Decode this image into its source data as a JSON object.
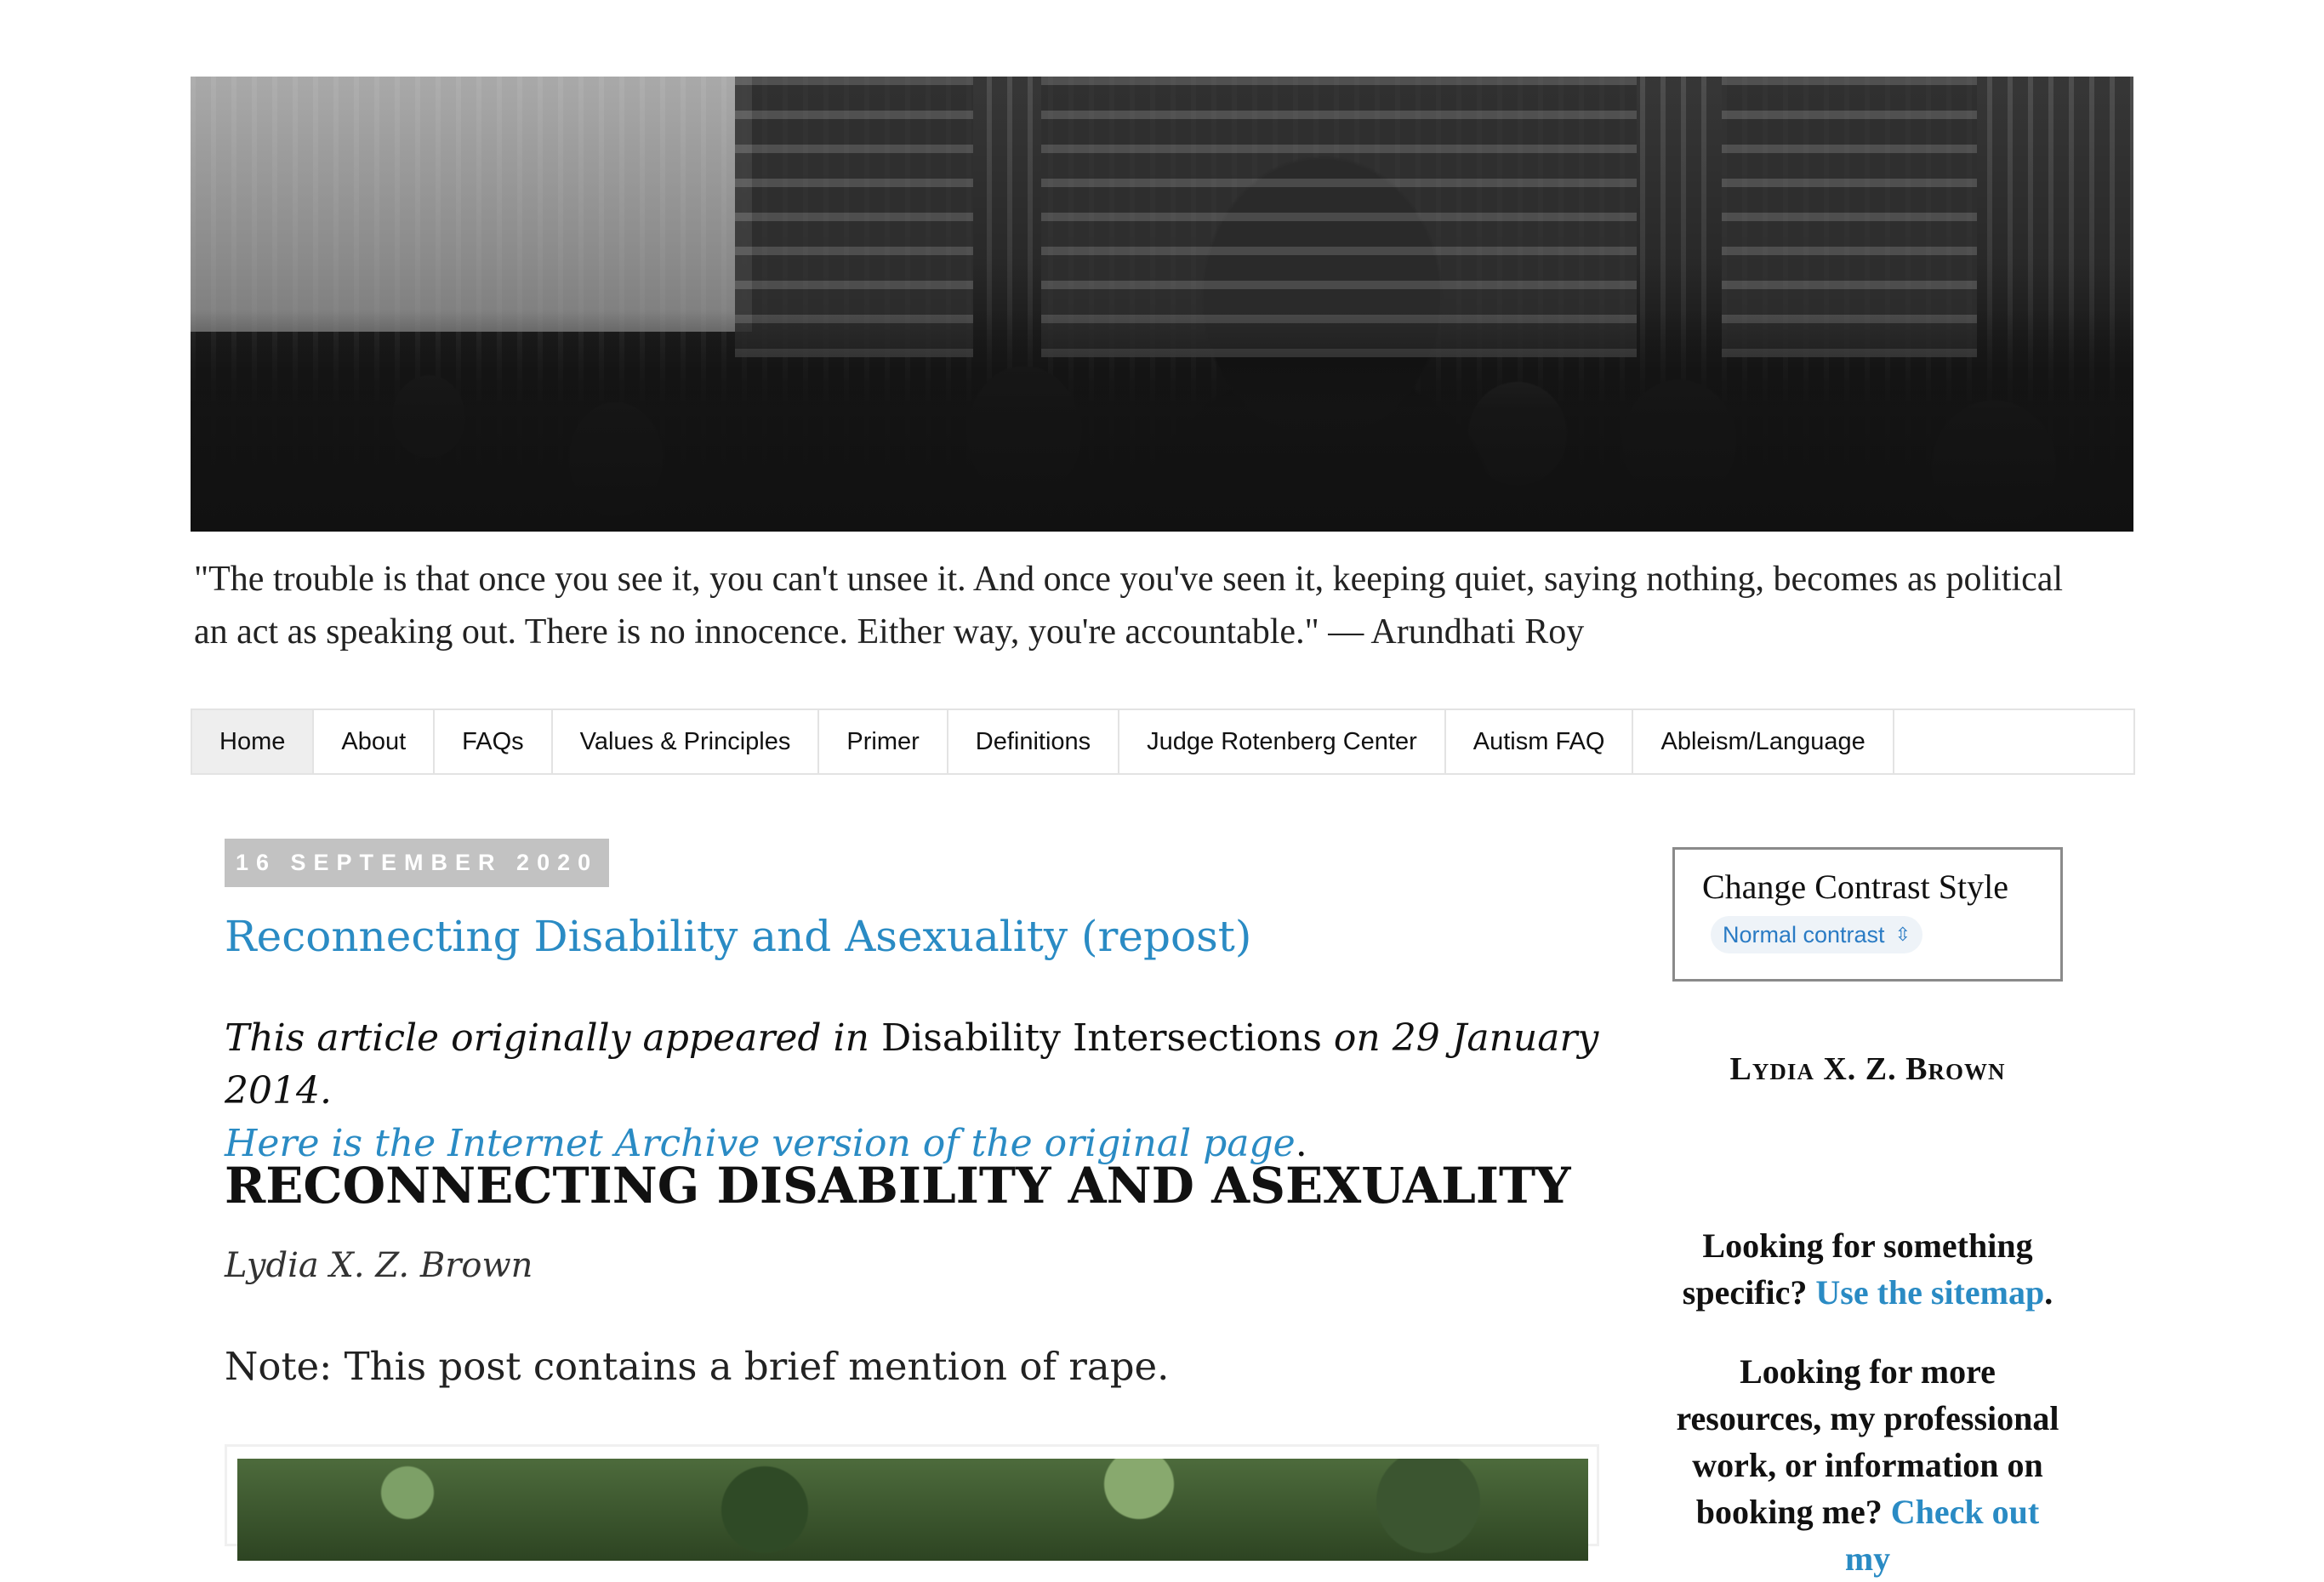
{
  "header": {
    "quote": "\"The trouble is that once you see it, you can't unsee it. And once you've seen it, keeping quiet, saying nothing, becomes as political an act as speaking out. There is no innocence. Either way, you're accountable.\" — Arundhati Roy"
  },
  "nav": {
    "tabs": [
      "Home",
      "About",
      "FAQs",
      "Values & Principles",
      "Primer",
      "Definitions",
      "Judge Rotenberg Center",
      "Autism FAQ",
      "Ableism/Language"
    ]
  },
  "post": {
    "date": "16 SEPTEMBER 2020",
    "title": "Reconnecting Disability and Asexuality (repost)",
    "intro_part1": "This article originally appeared in",
    "intro_publication": "Disability Intersections",
    "intro_part2": "on 29 January 2014.",
    "archive_link": "Here is the Internet Archive version of the original page",
    "archive_period": ".",
    "heading": "RECONNECTING DISABILITY AND ASEXUALITY",
    "author": "Lydia X. Z. Brown",
    "note": "Note: This post contains a brief mention of rape."
  },
  "sidebar": {
    "contrast_title": "Change Contrast Style",
    "contrast_value": "Normal contrast",
    "name": "Lydia X. Z. Brown",
    "sitemap_text": "Looking for something specific?",
    "sitemap_link": "Use the sitemap",
    "sitemap_period": ".",
    "resources_text": "Looking for more resources, my professional work, or information on booking me?",
    "resources_link": "Check out my"
  },
  "colors": {
    "link": "#2a8bc4",
    "badge_bg": "#c2c2c2",
    "tab_active_bg": "#eeeeee"
  }
}
